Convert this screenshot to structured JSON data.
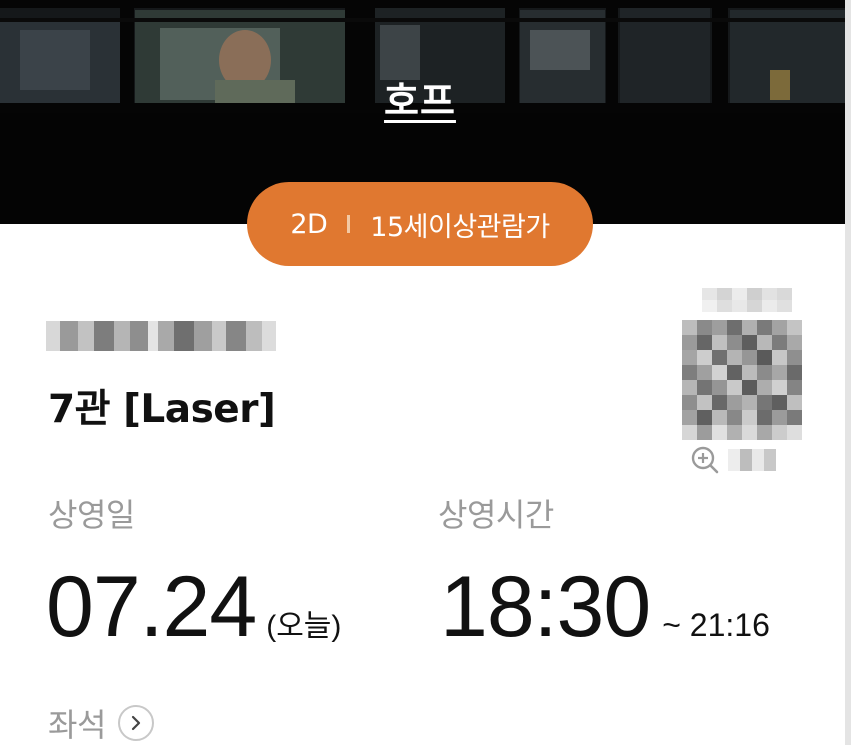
{
  "movie": {
    "title": "호프",
    "format": "2D",
    "rating": "15세이상관람가"
  },
  "ticket": {
    "screen": "7관 [Laser]",
    "date_label": "상영일",
    "date": "07.24",
    "date_suffix": "(오늘)",
    "time_label": "상영시간",
    "start_time": "18:30",
    "end_time": "~ 21:16",
    "seat_label": "좌석"
  },
  "icons": {
    "zoom": "zoom-in-icon",
    "chevron": "chevron-right-icon"
  },
  "colors": {
    "accent": "#e07830",
    "label_gray": "#9a9a9a",
    "text": "#111111"
  }
}
